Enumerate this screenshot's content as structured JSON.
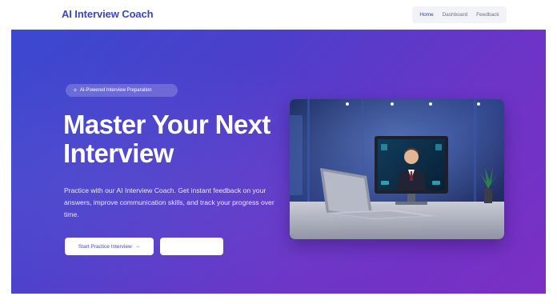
{
  "header": {
    "brand": "AI Interview Coach",
    "nav": [
      {
        "label": "Home",
        "active": true
      },
      {
        "label": "Dashboard",
        "active": false
      },
      {
        "label": "Feedback",
        "active": false
      }
    ]
  },
  "hero": {
    "badge": {
      "icon": "sparkle-icon",
      "label": "AI-Powered Interview Preparation"
    },
    "headline_line1": "Master Your Next",
    "headline_line2": "Interview",
    "description": "Practice with our AI Interview Coach. Get instant feedback on your answers, improve communication skills, and track your progress over time.",
    "primary_button": {
      "label": "Start Practice Interview",
      "icon": "arrow-right-icon"
    },
    "secondary_button": {
      "label": ""
    },
    "image": {
      "subject": "laptop-video-call-illustration"
    }
  },
  "colors": {
    "brand": "#3b46c2",
    "hero_gradient_start": "#3a49d0",
    "hero_gradient_end": "#7b2fc4"
  }
}
